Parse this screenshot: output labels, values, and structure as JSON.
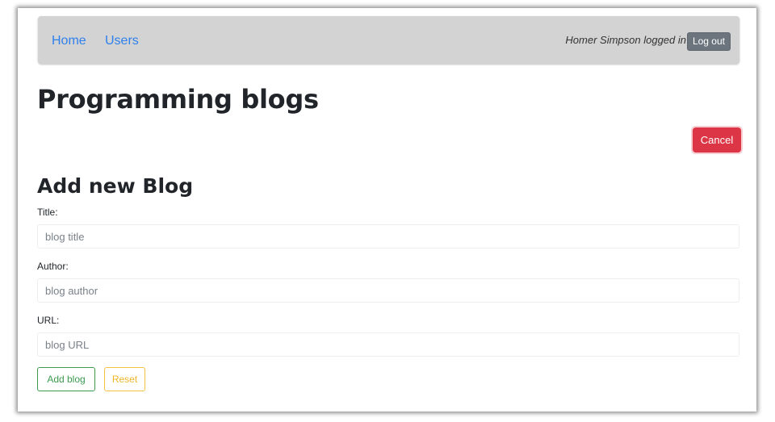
{
  "nav": {
    "home": "Home",
    "users": "Users",
    "login_status": "Homer Simpson logged in",
    "logout_label": "Log out"
  },
  "page": {
    "title": "Programming blogs",
    "cancel_label": "Cancel"
  },
  "form": {
    "heading": "Add new Blog",
    "fields": [
      {
        "label": "Title:",
        "placeholder": "blog title",
        "value": ""
      },
      {
        "label": "Author:",
        "placeholder": "blog author",
        "value": ""
      },
      {
        "label": "URL:",
        "placeholder": "blog URL",
        "value": ""
      }
    ],
    "submit_label": "Add blog",
    "reset_label": "Reset"
  },
  "colors": {
    "navbar_bg": "#d3d3d3",
    "link": "#2f80ed",
    "danger": "#dc3545",
    "success": "#3c9a4f",
    "warning": "#f0b429",
    "secondary": "#6c757d"
  }
}
